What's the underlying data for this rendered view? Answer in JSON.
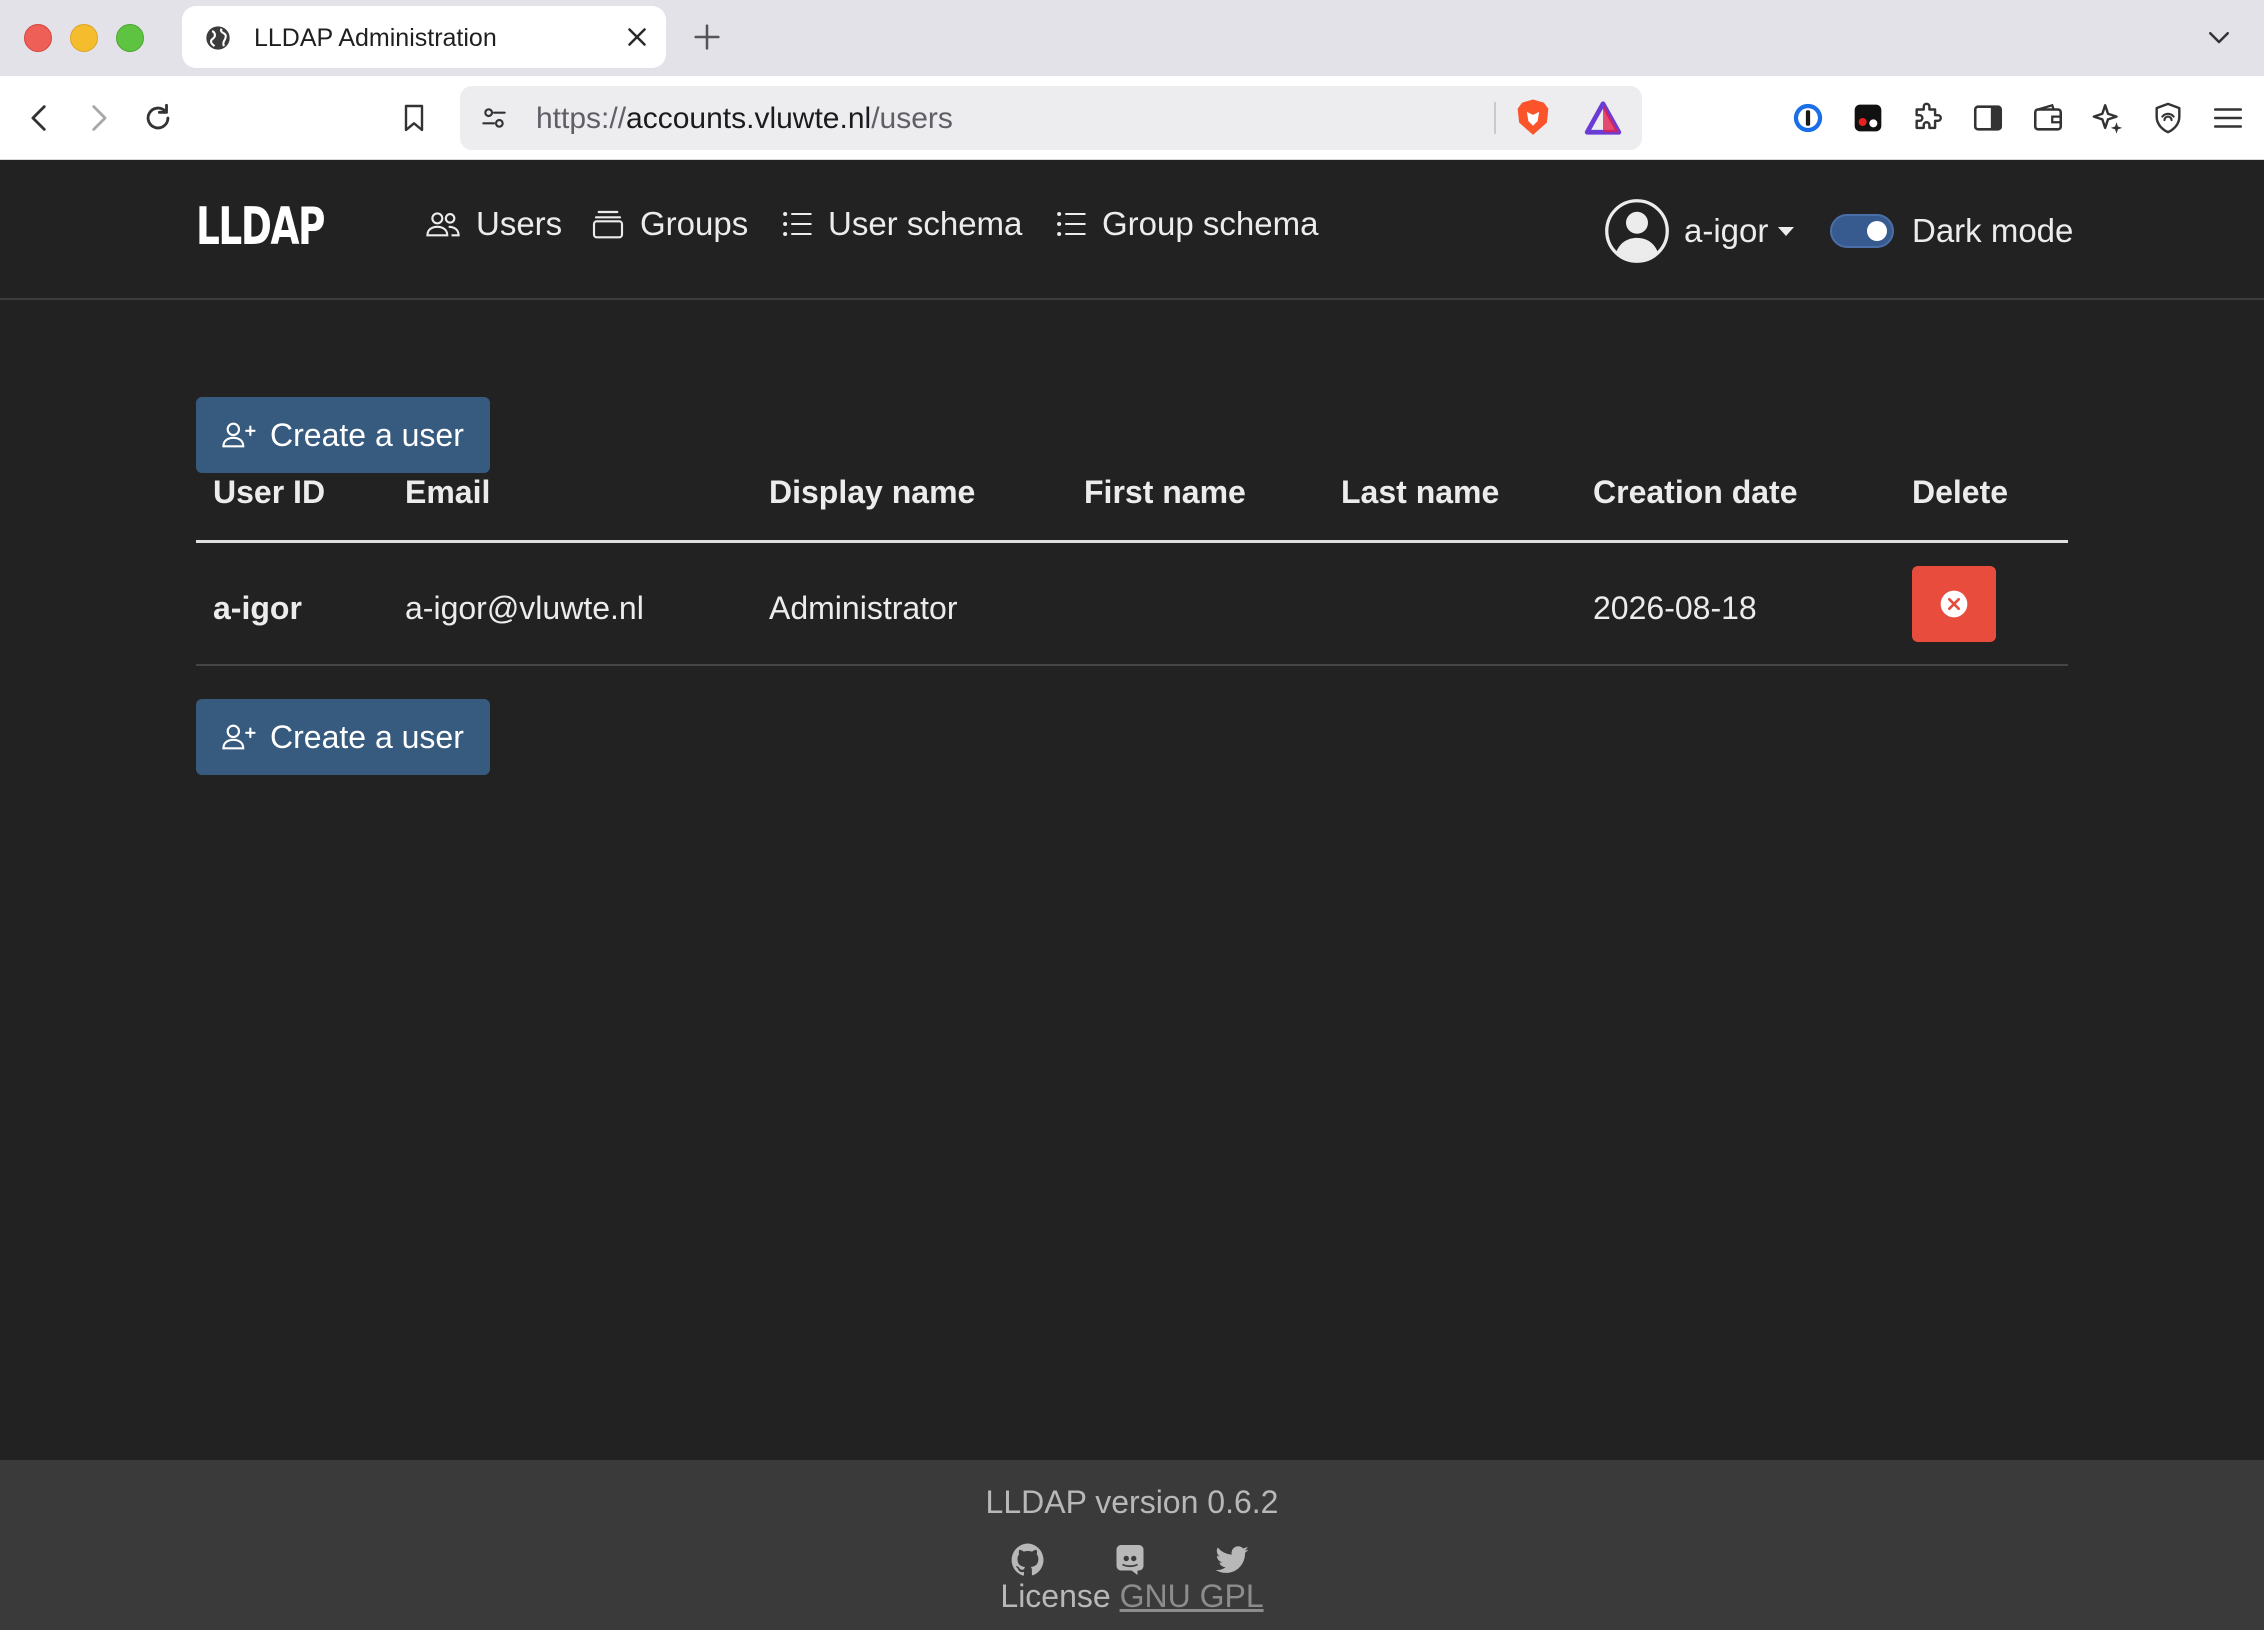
{
  "browser": {
    "tab_title": "LLDAP Administration",
    "url_prefix": "https://",
    "url_host": "accounts.vluwte.nl",
    "url_path": "/users"
  },
  "app": {
    "logo": "LLDAP",
    "nav": {
      "users": "Users",
      "groups": "Groups",
      "user_schema": "User schema",
      "group_schema": "Group schema"
    },
    "user_menu": "a-igor",
    "dark_mode_label": "Dark mode",
    "dark_mode_on": true,
    "create_user_label": "Create a user",
    "table": {
      "headers": [
        "User ID",
        "Email",
        "Display name",
        "First name",
        "Last name",
        "Creation date",
        "Delete"
      ],
      "rows": [
        {
          "user_id": "a-igor",
          "email": "a-igor@vluwte.nl",
          "display_name": "Administrator",
          "first_name": "",
          "last_name": "",
          "creation_date": "2026-08-18"
        }
      ]
    },
    "footer": {
      "version": "LLDAP version 0.6.2",
      "license_prefix": "License",
      "license_link": "GNU GPL"
    }
  },
  "colors": {
    "app_background": "#222222",
    "primary_button": "#375a7f",
    "danger_button": "#e74c3c",
    "footer_background": "#3a3a3a"
  }
}
